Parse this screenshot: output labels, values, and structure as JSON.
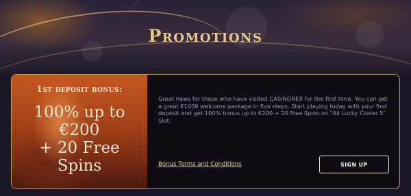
{
  "header": {
    "title": "Promotions"
  },
  "promo": {
    "kicker": "1st deposit bonus:",
    "headline_lines": [
      "100% up to",
      "€200",
      "+ 20 Free",
      "Spins"
    ],
    "description": "Great news for those who have visited CASINOREX for the first time. You can get a great €1000 welcome package in five steps. Start playing today with your first deposit and get 100% bonus up to €200 + 20 Free Spins on \"All Lucky Clover 5\" Slot.",
    "terms_label": "Bonus Terms and Conditions",
    "signup_label": "SIGN UP"
  },
  "colors": {
    "accent_gold": "#e7c88a",
    "card_border": "#c59a55",
    "body_text": "#8f9ab8"
  }
}
